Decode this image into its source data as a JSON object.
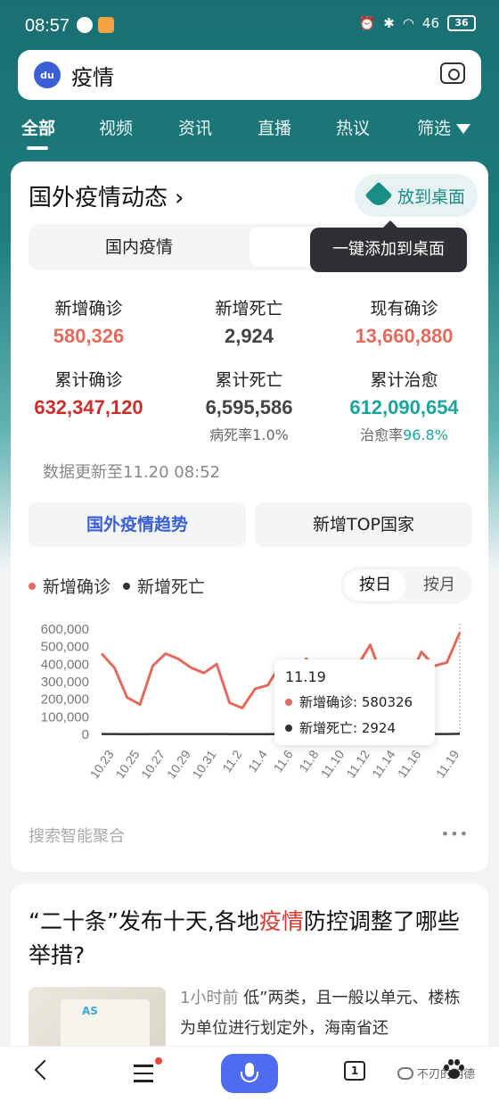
{
  "status_bar": {
    "time": "08:57",
    "signal": "46",
    "battery": "36"
  },
  "search": {
    "query": "疫情"
  },
  "tabs": [
    "全部",
    "视频",
    "资讯",
    "直播",
    "热议",
    "筛选"
  ],
  "card": {
    "title": "国外疫情动态",
    "desk_button": "放到桌面",
    "segment_left": "国内疫情",
    "tooltip": "一键添加到桌面",
    "stats": [
      {
        "label": "新增确诊",
        "value": "580,326"
      },
      {
        "label": "新增死亡",
        "value": "2,924"
      },
      {
        "label": "现有确诊",
        "value": "13,660,880"
      },
      {
        "label": "累计确诊",
        "value": "632,347,120"
      },
      {
        "label": "累计死亡",
        "value": "6,595,586",
        "sub_label": "病死率",
        "sub_value": "1.0%"
      },
      {
        "label": "累计治愈",
        "value": "612,090,654",
        "sub_label": "治愈率",
        "sub_value": "96.8%"
      }
    ],
    "update_time": "数据更新至11.20 08:52",
    "btn_trend": "国外疫情趋势",
    "btn_top": "新增TOP国家",
    "legend": [
      "新增确诊",
      "新增死亡"
    ],
    "toggle": [
      "按日",
      "按月"
    ],
    "aggregation": "搜索智能聚合",
    "more": "•••"
  },
  "chart_data": {
    "type": "line",
    "x": [
      "10.22",
      "10.23",
      "10.24",
      "10.25",
      "10.26",
      "10.27",
      "10.28",
      "10.29",
      "10.30",
      "10.31",
      "11.1",
      "11.2",
      "11.3",
      "11.4",
      "11.5",
      "11.6",
      "11.7",
      "11.8",
      "11.9",
      "11.10",
      "11.11",
      "11.12",
      "11.13",
      "11.14",
      "11.15",
      "11.16",
      "11.17",
      "11.18",
      "11.19"
    ],
    "x_tick_labels": [
      "10.23",
      "10.25",
      "10.27",
      "10.29",
      "10.31",
      "11.2",
      "11.4",
      "11.6",
      "11.8",
      "11.10",
      "11.12",
      "11.14",
      "11.16",
      "11.19"
    ],
    "y_tick_labels": [
      "600,000",
      "500,000",
      "400,000",
      "300,000",
      "200,000",
      "100,000",
      "0"
    ],
    "ylim": [
      0,
      600000
    ],
    "series": [
      {
        "name": "新增确诊",
        "color": "#e36a5c",
        "values": [
          460000,
          380000,
          210000,
          170000,
          390000,
          460000,
          430000,
          380000,
          350000,
          400000,
          180000,
          150000,
          260000,
          280000,
          400000,
          330000,
          430000,
          330000,
          360000,
          320000,
          390000,
          510000,
          310000,
          310000,
          310000,
          470000,
          390000,
          410000,
          580326
        ]
      },
      {
        "name": "新增死亡",
        "color": "#333333",
        "values": [
          1900,
          1800,
          1500,
          1400,
          1800,
          2000,
          2100,
          1900,
          1800,
          1800,
          1500,
          1400,
          1600,
          1700,
          2000,
          1900,
          2100,
          1900,
          1900,
          1900,
          2000,
          2200,
          1800,
          1800,
          1900,
          2300,
          2000,
          2100,
          2924
        ]
      }
    ],
    "tooltip": {
      "date": "11.19",
      "lines": [
        "新增确诊: 580326",
        "新增死亡: 2924"
      ]
    }
  },
  "news": {
    "title_a": "“二十条”发布十天,各地",
    "title_hl": "疫情",
    "title_b": "防控调整了哪些举措?",
    "meta": "1小时前",
    "snippet": " 低”两类，且一般以单元、楼栋为单位进行划定外，海南省还"
  },
  "bottom_nav": {
    "pages": "1",
    "wechat": "不刃的明德"
  }
}
